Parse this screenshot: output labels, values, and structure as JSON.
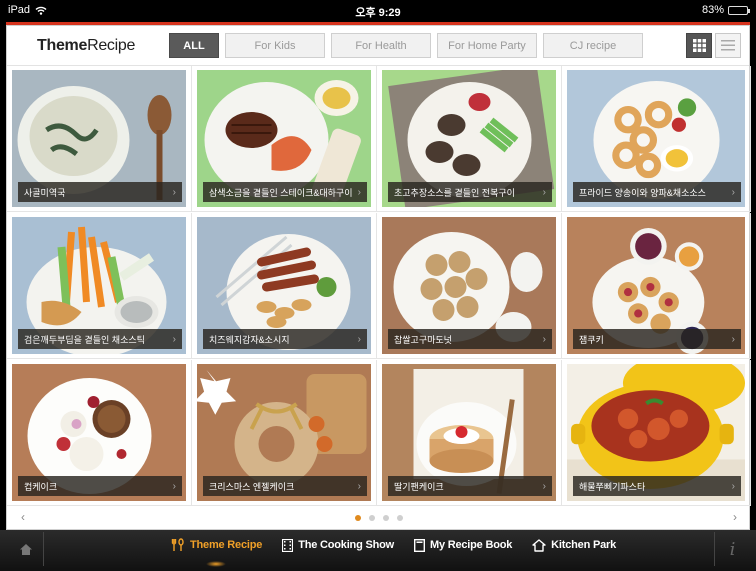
{
  "status": {
    "device": "iPad",
    "time": "오후 9:29",
    "battery": "83%",
    "battery_level": 0.83
  },
  "header": {
    "logo_bold": "Theme",
    "logo_light": "Recipe",
    "tabs": [
      {
        "label": "ALL",
        "active": true
      },
      {
        "label": "For Kids",
        "active": false
      },
      {
        "label": "For Health",
        "active": false
      },
      {
        "label": "For Home Party",
        "active": false
      },
      {
        "label": "CJ recipe",
        "active": false
      }
    ]
  },
  "recipes": [
    {
      "title": "사골미역국",
      "scene": "soup"
    },
    {
      "title": "삼색소금을 곁들인 스테이크&대하구이",
      "scene": "steak"
    },
    {
      "title": "초고추장소스를 곁들인 전복구이",
      "scene": "abalone"
    },
    {
      "title": "프라이드 양송이와 양파&채소소스",
      "scene": "rings"
    },
    {
      "title": "검은깨두부딥을 곁들인 채소스틱",
      "scene": "sticks"
    },
    {
      "title": "치즈웨지감자&소시지",
      "scene": "sausage"
    },
    {
      "title": "찹쌀고구마도넛",
      "scene": "donut"
    },
    {
      "title": "잼쿠키",
      "scene": "cookies"
    },
    {
      "title": "컵케이크",
      "scene": "cupcake"
    },
    {
      "title": "크리스마스 엔젤케이크",
      "scene": "wreath"
    },
    {
      "title": "딸기팬케이크",
      "scene": "pancake"
    },
    {
      "title": "해물쭈삐기파스타",
      "scene": "pot"
    }
  ],
  "pager": {
    "pages": 4,
    "current": 1
  },
  "bottom_nav": [
    {
      "label": "Theme Recipe",
      "icon": "fork-spoon-icon",
      "active": true
    },
    {
      "label": "The Cooking Show",
      "icon": "film-icon",
      "active": false
    },
    {
      "label": "My Recipe Book",
      "icon": "book-icon",
      "active": false
    },
    {
      "label": "Kitchen Park",
      "icon": "house-shape-icon",
      "active": false
    }
  ],
  "info_label": "i",
  "colors": {
    "accent": "#f0a028",
    "top_line": "#d6331d",
    "active_tab": "#5a5a5a"
  }
}
